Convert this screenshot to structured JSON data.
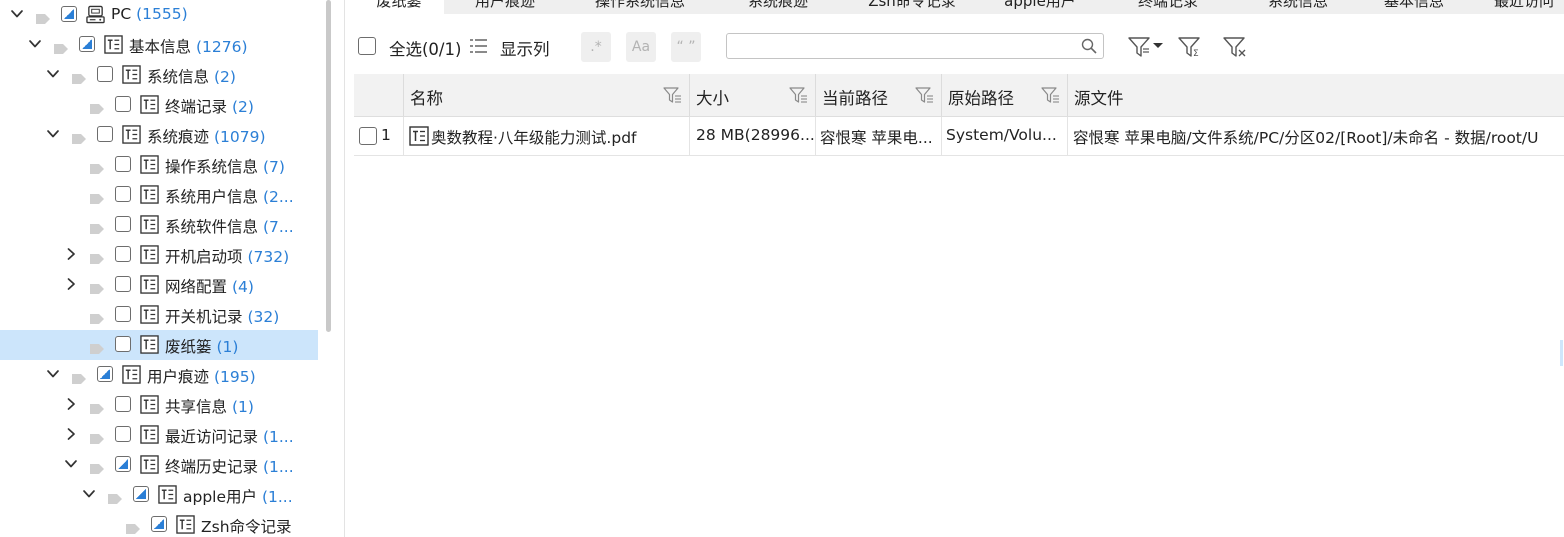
{
  "tree": {
    "items": [
      {
        "label": "PC",
        "count": "(1555)",
        "expander": "down",
        "check": "partial",
        "icon": "device-icon"
      },
      {
        "label": "基本信息",
        "count": "(1276)",
        "expander": "down",
        "check": "partial",
        "icon": "table-icon"
      },
      {
        "label": "系统信息",
        "count": "(2)",
        "expander": "down",
        "check": "empty",
        "icon": "table-icon"
      },
      {
        "label": "终端记录",
        "count": "(2)",
        "expander": "none",
        "check": "empty",
        "icon": "table-icon"
      },
      {
        "label": "系统痕迹",
        "count": "(1079)",
        "expander": "down",
        "check": "empty",
        "icon": "table-icon"
      },
      {
        "label": "操作系统信息",
        "count": "(7)",
        "expander": "none",
        "check": "empty",
        "icon": "table-icon"
      },
      {
        "label": "系统用户信息",
        "count": "(2...",
        "expander": "none",
        "check": "empty",
        "icon": "table-icon"
      },
      {
        "label": "系统软件信息",
        "count": "(7...",
        "expander": "none",
        "check": "empty",
        "icon": "table-icon"
      },
      {
        "label": "开机启动项",
        "count": "(732)",
        "expander": "right",
        "check": "empty",
        "icon": "table-icon"
      },
      {
        "label": "网络配置",
        "count": "(4)",
        "expander": "right",
        "check": "empty",
        "icon": "table-icon"
      },
      {
        "label": "开关机记录",
        "count": "(32)",
        "expander": "none",
        "check": "empty",
        "icon": "table-icon"
      },
      {
        "label": "废纸篓",
        "count": "(1)",
        "expander": "none",
        "check": "empty",
        "icon": "table-icon",
        "selected": true
      },
      {
        "label": "用户痕迹",
        "count": "(195)",
        "expander": "down",
        "check": "partial",
        "icon": "table-icon"
      },
      {
        "label": "共享信息",
        "count": "(1)",
        "expander": "right",
        "check": "empty",
        "icon": "table-icon"
      },
      {
        "label": "最近访问记录",
        "count": "(1...",
        "expander": "right",
        "check": "empty",
        "icon": "table-icon"
      },
      {
        "label": "终端历史记录",
        "count": "(1...",
        "expander": "down",
        "check": "partial",
        "icon": "table-icon"
      },
      {
        "label": "apple用户",
        "count": "(1...",
        "expander": "down",
        "check": "partial",
        "icon": "table-icon"
      },
      {
        "label": "Zsh命令记录",
        "count": "",
        "expander": "none",
        "check": "partial",
        "icon": "table-icon"
      }
    ]
  },
  "tabs": [
    {
      "label": "废纸篓",
      "active": true
    },
    {
      "label": "用户痕迹"
    },
    {
      "label": "操作系统信息"
    },
    {
      "label": "系统痕迹"
    },
    {
      "label": "Zsh命令记录"
    },
    {
      "label": "apple用户"
    },
    {
      "label": "终端记录"
    },
    {
      "label": "系统信息"
    },
    {
      "label": "基本信息"
    },
    {
      "label": "最近访问"
    }
  ],
  "toolbar": {
    "select_all_label": "全选(0/1)",
    "show_columns_label": "显示列",
    "regex_label": ".*",
    "case_label": "Aa",
    "quote_label": "“ ”",
    "search_value": "",
    "search_placeholder": ""
  },
  "grid": {
    "columns": [
      "",
      "名称",
      "大小",
      "当前路径",
      "原始路径",
      "源文件"
    ],
    "rows": [
      {
        "index": "1",
        "name": "奥数教程·八年级能力测试.pdf",
        "size": "28 MB(28996...",
        "current_path": "容恨寒 苹果电...",
        "original_path": "System/Volu...",
        "source_file": "容恨寒 苹果电脑/文件系统/PC/分区02/[Root]/未命名 - 数据/root/U"
      }
    ]
  },
  "colors": {
    "accent": "#2b7fd6",
    "selected_row": "#cce5fb",
    "header_bg": "#f2f2f2"
  }
}
